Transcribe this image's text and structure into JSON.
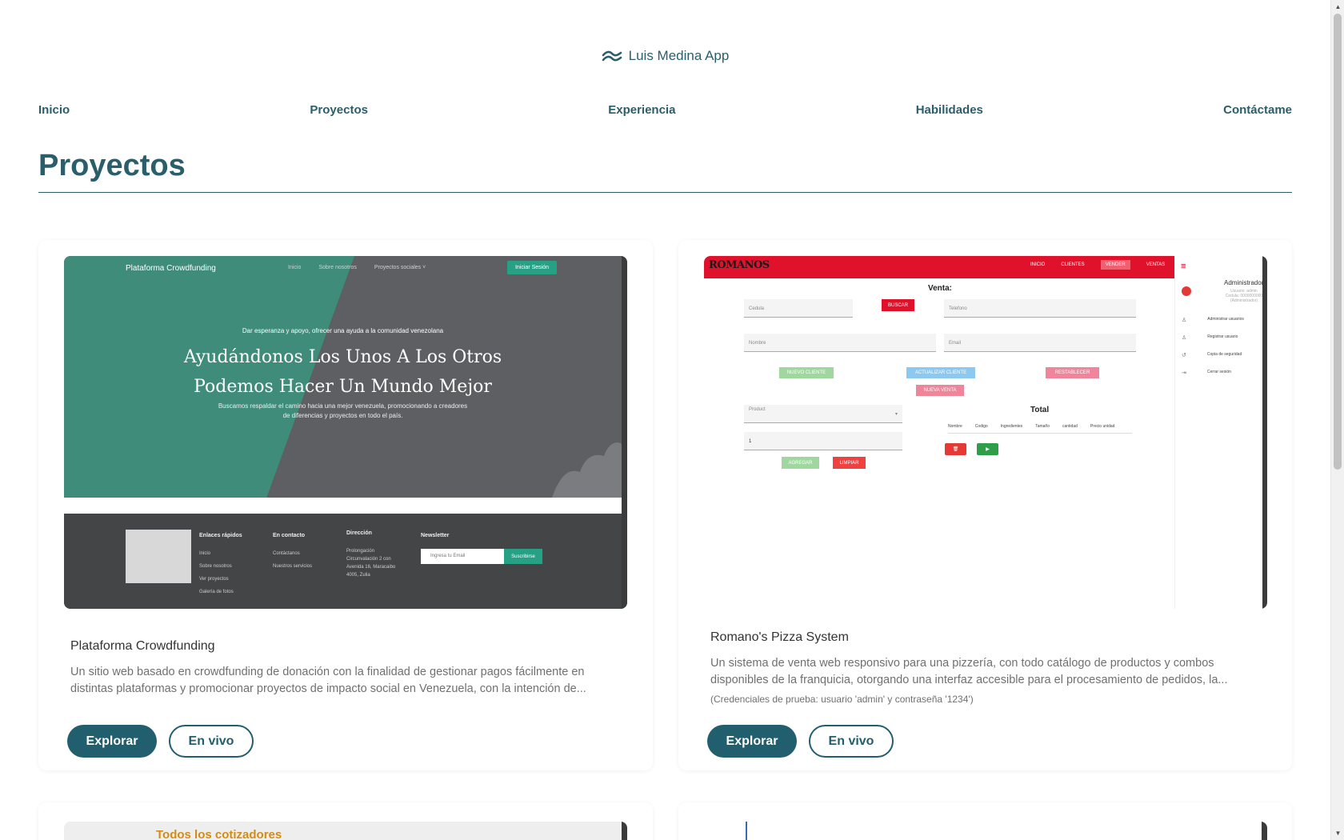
{
  "brand": {
    "name": "Luis Medina App",
    "icon": "wave-logo-icon"
  },
  "nav": [
    "Inicio",
    "Proyectos",
    "Experiencia",
    "Habilidades",
    "Contáctame"
  ],
  "section_title": "Proyectos",
  "colors": {
    "primary": "#225f6e",
    "text": "#2a5e6b",
    "accent_green": "#27a185",
    "pizza_red": "#e0112b"
  },
  "projects": [
    {
      "title": "Plataforma Crowdfunding",
      "description": "Un sitio web basado en crowdfunding de donación con la finalidad de gestionar pagos fácilmente en distintas plataformas y promocionar proyectos de impacto social en Venezuela, con la intención de...",
      "explore_label": "Explorar",
      "live_label": "En vivo",
      "preview": {
        "header_title": "Plataforma Crowdfunding",
        "links": [
          "Inicio",
          "Sobre nosotros",
          "Proyectos sociales ˅"
        ],
        "login_button": "Iniciar Sesión",
        "tagline": "Dar esperanza y apoyo, ofrecer una ayuda a la comunidad venezolana",
        "headline_1": "Ayudándonos Los Unos A Los Otros",
        "headline_2": "Podemos Hacer Un Mundo Mejor",
        "subtext": "Buscamos respaldar el camino hacia una mejor venezuela, promocionando a creadores de diferencias y proyectos en todo el país.",
        "footer": {
          "quick_links_title": "Enlaces rápidos",
          "quick_links": [
            "Inicio",
            "Sobre nosotros",
            "Ver proyectos",
            "Galería de fotos"
          ],
          "contact_title": "En contacto",
          "contact_links": [
            "Contáctanos",
            "Nuestros servicios"
          ],
          "address_title": "Dirección",
          "address": "Prolongación Circunvalación 2 con Avenida 16, Maracaibo 4005, Zulia",
          "newsletter_title": "Newsletter",
          "newsletter_placeholder": "Ingresa tu Email",
          "newsletter_button": "Suscribirse"
        }
      }
    },
    {
      "title": "Romano's Pizza System",
      "description": "Un sistema de venta web responsivo para una pizzería, con todo catálogo de productos y combos disponibles de la franquicia, otorgando una interfaz accesible para el procesamiento de pedidos, la...",
      "note": "(Credenciales de prueba: usuario 'admin' y contraseña '1234')",
      "explore_label": "Explorar",
      "live_label": "En vivo",
      "preview": {
        "logo": "ROMANOS",
        "menu": [
          "INICIO",
          "CLIENTES",
          "VENDER",
          "VENTAS"
        ],
        "heading": "Venta:",
        "fields": [
          "Cedula",
          "Telefono",
          "Nombre",
          "Email",
          "Product",
          "1"
        ],
        "buttons": [
          "BUSCAR",
          "NUEVO CLIENTE",
          "ACTUALIZAR CLIENTE",
          "RESTABLECER",
          "NUEVA VENTA",
          "AGREGAR",
          "LIMPIAR"
        ],
        "total_label": "Total",
        "table_headers": [
          "Nombre",
          "Codigo",
          "Ingredientes",
          "Tamaño",
          "cantidad",
          "Precio unidad"
        ],
        "admin_name": "Administrador",
        "admin_sub": [
          "Usuario: admin",
          "Cedula: 0000000000",
          "(Administrador)"
        ],
        "side_menu": [
          "Administrar usuarios",
          "Registrar usuario",
          "Copia de seguridad",
          "Cerrar sesión"
        ]
      }
    }
  ],
  "next_row": {
    "left_preview_title": "Todos los cotizadores"
  }
}
